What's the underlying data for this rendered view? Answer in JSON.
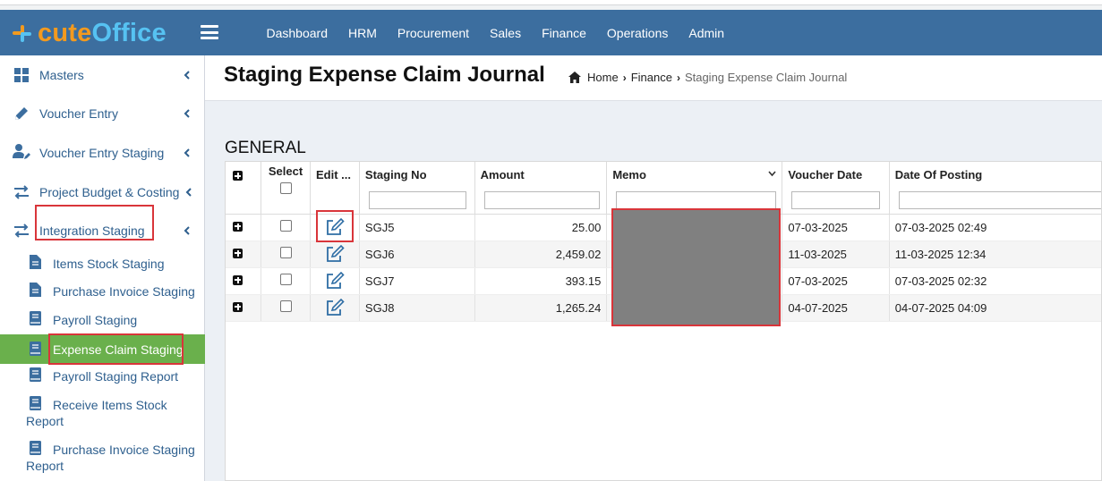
{
  "brand": {
    "part1": "cute",
    "part2": "Office"
  },
  "topnav": [
    "Dashboard",
    "HRM",
    "Procurement",
    "Sales",
    "Finance",
    "Operations",
    "Admin"
  ],
  "sidebar": {
    "main": [
      {
        "label": "Masters",
        "icon": "grid-icon"
      },
      {
        "label": "Voucher Entry",
        "icon": "pencil-icon"
      },
      {
        "label": "Voucher Entry Staging",
        "icon": "user-edit-icon"
      },
      {
        "label": "Project Budget & Costing",
        "icon": "exchange-icon"
      },
      {
        "label": "Integration Staging",
        "icon": "exchange-icon"
      }
    ],
    "sub": [
      {
        "label": "Items Stock Staging",
        "icon": "file-icon"
      },
      {
        "label": "Purchase Invoice Staging",
        "icon": "file-icon"
      },
      {
        "label": "Payroll Staging",
        "icon": "book-icon"
      },
      {
        "label": "Expense Claim Staging",
        "icon": "book-icon",
        "active": true
      },
      {
        "label": "Payroll Staging Report",
        "icon": "book-icon"
      },
      {
        "label_line1": "Receive Items Stock",
        "label_line2": "Report",
        "icon": "book-icon"
      },
      {
        "label_line1": "Purchase Invoice Staging",
        "label_line2": "Report",
        "icon": "book-icon"
      }
    ]
  },
  "page": {
    "title": "Staging Expense Claim Journal",
    "breadcrumb": {
      "home": "Home",
      "section": "Finance",
      "current": "Staging Expense Claim Journal"
    },
    "section_title": "GENERAL"
  },
  "grid": {
    "columns": [
      "Select",
      "Edit ...",
      "Staging No",
      "Amount",
      "Memo",
      "Voucher Date",
      "Date Of Posting"
    ],
    "rows": [
      {
        "staging_no": "SGJ5",
        "amount": "25.00",
        "voucher_date": "07-03-2025",
        "date_of_posting": "07-03-2025 02:49"
      },
      {
        "staging_no": "SGJ6",
        "amount": "2,459.02",
        "voucher_date": "11-03-2025",
        "date_of_posting": "11-03-2025 12:34"
      },
      {
        "staging_no": "SGJ7",
        "amount": "393.15",
        "voucher_date": "07-03-2025",
        "date_of_posting": "07-03-2025 02:32"
      },
      {
        "staging_no": "SGJ8",
        "amount": "1,265.24",
        "voucher_date": "04-07-2025",
        "date_of_posting": "04-07-2025 04:09"
      }
    ]
  },
  "colors": {
    "header": "#3c6e9f",
    "active": "#6ab04c",
    "highlight": "#d9353a",
    "link": "#2e5f8e"
  }
}
